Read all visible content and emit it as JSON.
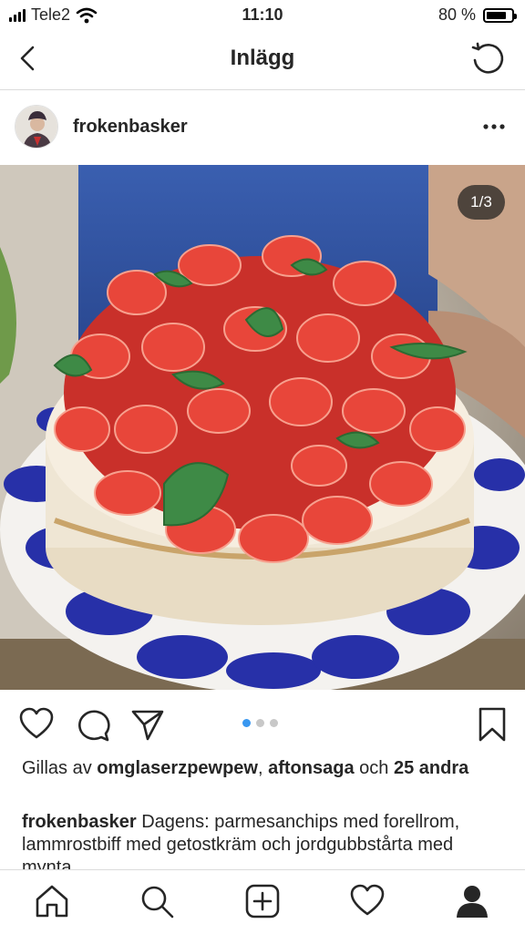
{
  "status_bar": {
    "carrier": "Tele2",
    "time": "11:10",
    "battery_percent": "80 %",
    "battery_level": 0.8
  },
  "header": {
    "title": "Inlägg",
    "back_icon": "chevron-left-icon",
    "refresh_icon": "refresh-icon"
  },
  "post": {
    "username": "frokenbasker",
    "more_icon": "more-horizontal-icon",
    "image_counter": "1/3",
    "image_description": "photo-strawberry-cake",
    "carousel": {
      "total": 3,
      "active": 1
    },
    "likes": {
      "prefix": "Gillas av",
      "user1": "omglaserzpewpew",
      "separator": ",",
      "user2": "aftonsaga",
      "middle": "och",
      "others": "25 andra"
    },
    "caption": {
      "author": "frokenbasker",
      "text": "Dagens: parmesanchips med forellrom, lammrostbiff med getostkräm och jordgubbstårta med mynta"
    }
  },
  "action_icons": [
    "heart-icon",
    "comment-icon",
    "share-icon",
    "bookmark-icon"
  ],
  "tab_bar": {
    "items": [
      "home-icon",
      "search-icon",
      "add-post-icon",
      "activity-heart-icon",
      "profile-icon"
    ]
  },
  "colors": {
    "accent_blue": "#3897f0",
    "text": "#262626",
    "divider": "#dbdbdb",
    "plate_blue": "#2730a8",
    "strawberry": "#e03a2e"
  }
}
